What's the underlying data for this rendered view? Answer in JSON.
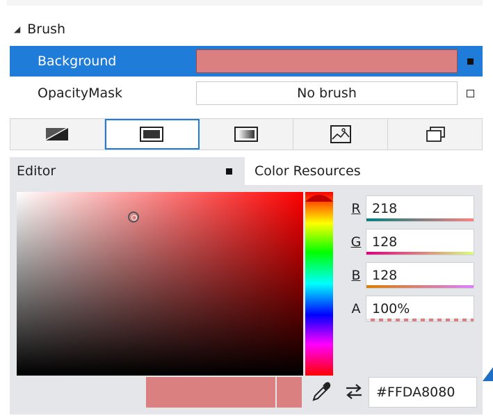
{
  "brush_section": {
    "title": "Brush"
  },
  "properties": [
    {
      "name": "Background",
      "value": "",
      "selected": true
    },
    {
      "name": "OpacityMask",
      "value": "No brush",
      "selected": false
    }
  ],
  "brush_tabs": [
    {
      "icon": "no-brush-icon",
      "active": false
    },
    {
      "icon": "solid-color-brush-icon",
      "active": true
    },
    {
      "icon": "gradient-brush-icon",
      "active": false
    },
    {
      "icon": "image-brush-icon",
      "active": false
    },
    {
      "icon": "brush-resources-icon",
      "active": false
    }
  ],
  "editor": {
    "tab_label": "Editor",
    "resources_label": "Color Resources"
  },
  "channels": [
    {
      "letter": "R",
      "value": "218"
    },
    {
      "letter": "G",
      "value": "128"
    },
    {
      "letter": "B",
      "value": "128"
    },
    {
      "letter": "A",
      "value": "100%"
    }
  ],
  "hex_value": "#FFDA8080",
  "colors": {
    "selected_blue": "#1F7CD8",
    "current_color": "#DA8080",
    "panel_gray": "#E4E6E9"
  }
}
